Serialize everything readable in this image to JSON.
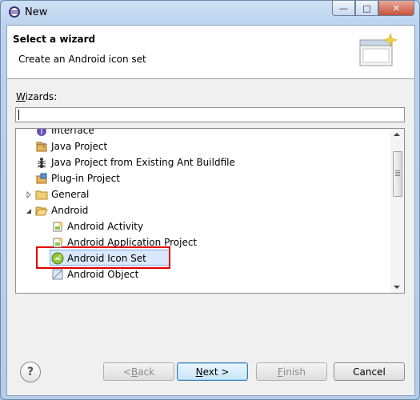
{
  "window": {
    "title": "New",
    "minimize": "—",
    "maximize": "□",
    "close": "✕"
  },
  "header": {
    "title": "Select a wizard",
    "description": "Create an Android icon set"
  },
  "wizards_label_prefix": "W",
  "wizards_label_rest": "izards:",
  "filter": {
    "value": ""
  },
  "tree": [
    {
      "label": "Interface",
      "icon": "interface-icon"
    },
    {
      "label": "Java Project",
      "icon": "java-project-icon"
    },
    {
      "label": "Java Project from Existing Ant Buildfile",
      "icon": "ant-icon"
    },
    {
      "label": "Plug-in Project",
      "icon": "plugin-project-icon"
    },
    {
      "label": "General",
      "icon": "folder-icon",
      "expanded": false
    },
    {
      "label": "Android",
      "icon": "folder-open-icon",
      "expanded": true
    },
    {
      "label": "Android Activity",
      "icon": "android-activity-icon"
    },
    {
      "label": "Android Application Project",
      "icon": "android-project-icon"
    },
    {
      "label": "Android Icon Set",
      "icon": "android-icon-set-icon",
      "selected": true
    },
    {
      "label": "Android Object",
      "icon": "android-object-icon"
    }
  ],
  "buttons": {
    "help": "?",
    "back_prefix": "< ",
    "back_mn": "B",
    "back_rest": "ack",
    "next_mn": "N",
    "next_rest": "ext >",
    "finish_mn": "F",
    "finish_rest": "inish",
    "cancel": "Cancel"
  },
  "colors": {
    "selection_border": "#7ea8dc",
    "highlight": "#e00000",
    "title_gradient": "#bcd3ee"
  }
}
